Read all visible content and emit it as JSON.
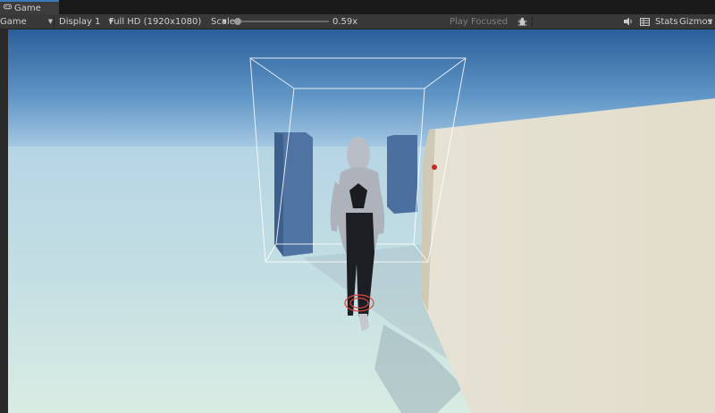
{
  "window": {
    "tab_title": "Game",
    "tab_icon": "gamepad-icon"
  },
  "toolbar": {
    "view_mode": "Game",
    "display": "Display 1",
    "resolution": "Full HD (1920x1080)",
    "scale_label": "Scale",
    "scale_value": "0.59x",
    "play_mode": "Play Focused",
    "stats_label": "Stats",
    "gizmos_label": "Gizmos"
  },
  "colors": {
    "accent": "#3a79bb",
    "toolbar_bg": "#383838",
    "tab_bg": "#191919"
  }
}
